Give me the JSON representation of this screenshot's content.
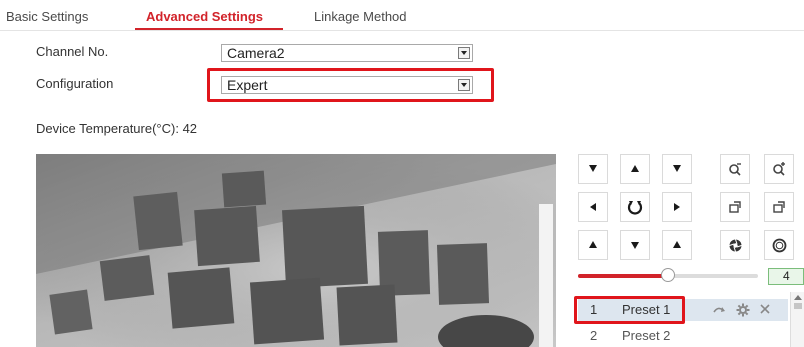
{
  "tabs": [
    {
      "label": "Basic Settings",
      "active": false
    },
    {
      "label": "Advanced Settings",
      "active": true
    },
    {
      "label": "Linkage Method",
      "active": false
    }
  ],
  "form": {
    "channel": {
      "label": "Channel No.",
      "value": "Camera2"
    },
    "configuration": {
      "label": "Configuration",
      "value": "Expert"
    }
  },
  "device_temperature": {
    "label": "Device Temperature(°C): ",
    "value": "42"
  },
  "ptz": {
    "buttons": [
      [
        "arrow-up-left-icon",
        "arrow-up-icon",
        "arrow-up-right-icon",
        "zoom-out-icon",
        "zoom-in-icon"
      ],
      [
        "arrow-left-icon",
        "auto-pan-icon",
        "arrow-right-icon",
        "focus-near-icon",
        "focus-far-icon"
      ],
      [
        "arrow-down-left-icon",
        "arrow-down-icon",
        "arrow-down-right-icon",
        "iris-close-icon",
        "iris-open-icon"
      ]
    ],
    "speed": {
      "value": "4",
      "level_fraction": 0.5
    }
  },
  "presets": [
    {
      "number": "1",
      "name": "Preset 1",
      "selected": true
    },
    {
      "number": "2",
      "name": "Preset 2",
      "selected": false
    }
  ],
  "preset_actions": [
    "call-preset-icon",
    "set-preset-icon",
    "delete-preset-icon"
  ],
  "colors": {
    "accent": "#d2232a",
    "highlight_box": "#e0151b",
    "selected_row": "#dde6ef"
  }
}
